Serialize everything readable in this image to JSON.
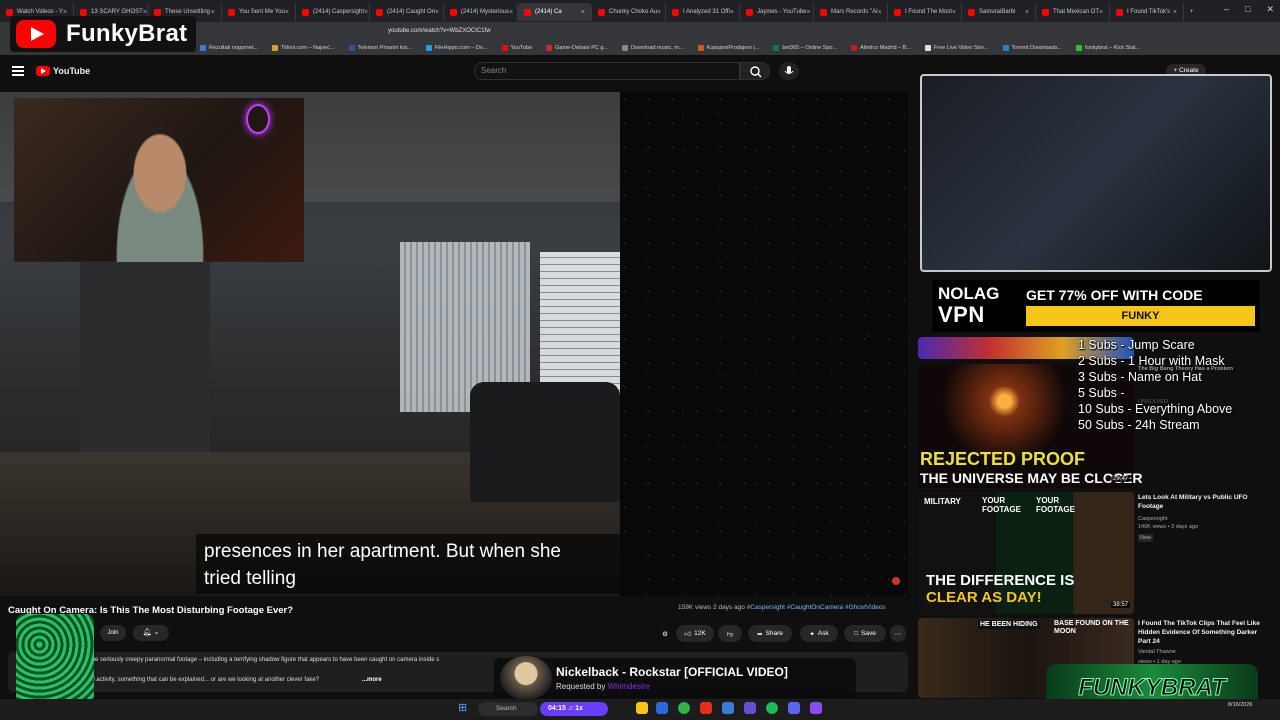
{
  "browser": {
    "tabs": [
      {
        "label": "Watch Videos - Y"
      },
      {
        "label": "13 SCARY GHOST"
      },
      {
        "label": "These Unsettling"
      },
      {
        "label": "You Sent Me You"
      },
      {
        "label": "(2414) Caspersight"
      },
      {
        "label": "(2414) Caught On"
      },
      {
        "label": "(2414) Mysterious"
      },
      {
        "label": "(2414) Ca",
        "active": true
      },
      {
        "label": "Chunky Choko Au"
      },
      {
        "label": "I Analyzed 31 Offi"
      },
      {
        "label": "Jaymes - YouTube"
      },
      {
        "label": "Mars Records \"Al"
      },
      {
        "label": "I Found The Most"
      },
      {
        "label": "SamuraiBarbi"
      },
      {
        "label": "That Mexican OT"
      },
      {
        "label": "I Found TikTok's"
      }
    ],
    "url": "youtube.com/watch?v=WbZXOCIC1fw",
    "bookmarks": [
      {
        "label": "Rezultati nogomet...",
        "color": "#3a7bd5"
      },
      {
        "label": "Titlovi.com – Najveć...",
        "color": "#e0a020"
      },
      {
        "label": "Telemon Privatni kor...",
        "color": "#3050a0"
      },
      {
        "label": "FileHippo.com – Do...",
        "color": "#20a0e0"
      },
      {
        "label": "YouTube",
        "color": "#ff0000"
      },
      {
        "label": "Game-Debate PC g...",
        "color": "#c03030"
      },
      {
        "label": "Download music, m...",
        "color": "#888888"
      },
      {
        "label": "KupujemProdajem |...",
        "color": "#e05020"
      },
      {
        "label": "bet365 – Online Spo...",
        "color": "#0a7a4a"
      },
      {
        "label": "Atletico Madrid – B...",
        "color": "#c02020"
      },
      {
        "label": "Free Live Video Stre...",
        "color": "#e0e0e0"
      },
      {
        "label": "Torrent Downloads...",
        "color": "#3080c0"
      },
      {
        "label": "funkybrat – Kick Stat...",
        "color": "#30c030"
      }
    ]
  },
  "stream": {
    "name": "FunkyBrat"
  },
  "youtube": {
    "logo": "YouTube",
    "search_placeholder": "Search",
    "create_label": "Create",
    "video": {
      "subtitle_line1": "presences in her apartment. But when she",
      "subtitle_line2": "tried telling",
      "title": "Caught On Camera: Is This The Most Disturbing Footage Ever?",
      "views": "159K views",
      "posted": "2 days ago",
      "tags": "#Caspersight #CaughtOnCamera #GhostVideos",
      "join_label": "Join",
      "likes": "12K",
      "share_label": "Share",
      "ask_label": "Ask",
      "save_label": "Save",
      "desc_line1": "me seriously creepy paranormal footage – including a terrifying shadow figure that appears to have been caught on camera inside s",
      "desc_line2": "al activity, something that can be explained... or are we looking at another clever fake?",
      "more_label": "...more"
    },
    "sidebar": [
      {
        "title": "The Big Bang Theory Has a Problem",
        "channel": "UNSOLVED"
      },
      {
        "thumb_text1": "REJECTED PROOF",
        "thumb_text2": "THE UNIVERSE MAY BE CLOSER",
        "duration": "29:47"
      },
      {
        "title": "Lets Look At  Military vs Public UFO Footage",
        "channel": "Caspersight",
        "meta": "140K views • 3 days ago",
        "badge": "New",
        "thumb_text1": "THE DIFFERENCE IS",
        "thumb_text2": "CLEAR AS DAY!",
        "thumb_tag1": "MILITARY",
        "thumb_tag2": "YOUR FOOTAGE",
        "thumb_tag3": "YOUR FOOTAGE",
        "duration": "38:57"
      },
      {
        "title": "I Found The TikTok Clips That Feel Like Hidden Evidence Of Something Darker Part 24",
        "channel": "Vandal Thawne",
        "meta": "views • 1 day ago",
        "thumb_tag1": "HE BEEN HIDING",
        "thumb_tag2": "BASE FOUND ON THE MOON"
      }
    ]
  },
  "overlays": {
    "vpn": {
      "logo_top": "NOLAG",
      "logo_bottom": "VPN",
      "offer": "GET 77% OFF WITH CODE",
      "code": "FUNKY"
    },
    "sub_goals": [
      "1 Subs - Jump Scare",
      "2 Subs - 1 Hour with Mask",
      "3 Subs - Name on Hat",
      "5 Subs -",
      "10 Subs - Everything Above",
      "50 Subs - 24h Stream"
    ],
    "now_playing": {
      "song": "Nickelback - Rockstar [OFFICIAL VIDEO]",
      "requested_prefix": "Requested by",
      "requested_by": "Whimdesire"
    },
    "funky_logo": "FUNKYBRAT"
  },
  "taskbar": {
    "search_label": "Search",
    "timer": "04:15",
    "speed": "1x",
    "date": "8/16/2026"
  }
}
